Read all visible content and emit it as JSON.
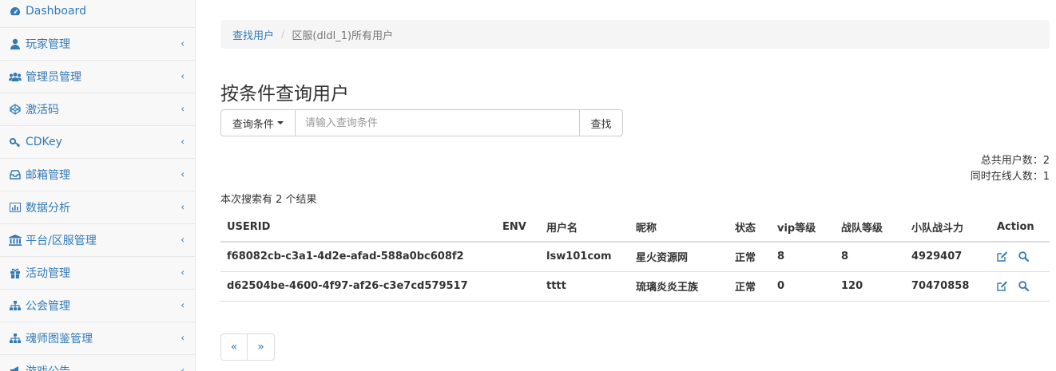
{
  "sidebar": {
    "items": [
      {
        "label": "Dashboard",
        "icon": "dashboard-icon",
        "has_submenu": false
      },
      {
        "label": "玩家管理",
        "icon": "user-icon",
        "has_submenu": true
      },
      {
        "label": "管理员管理",
        "icon": "users-icon",
        "has_submenu": true
      },
      {
        "label": "激活码",
        "icon": "codepen-icon",
        "has_submenu": true
      },
      {
        "label": "CDKey",
        "icon": "key-icon",
        "has_submenu": true
      },
      {
        "label": "邮箱管理",
        "icon": "inbox-icon",
        "has_submenu": true
      },
      {
        "label": "数据分析",
        "icon": "bar-chart-icon",
        "has_submenu": true
      },
      {
        "label": "平台/区服管理",
        "icon": "bank-icon",
        "has_submenu": true
      },
      {
        "label": "活动管理",
        "icon": "gift-icon",
        "has_submenu": true
      },
      {
        "label": "公会管理",
        "icon": "sitemap-icon",
        "has_submenu": true
      },
      {
        "label": "魂师图鉴管理",
        "icon": "sitemap-icon",
        "has_submenu": true
      },
      {
        "label": "游戏公告",
        "icon": "bullhorn-icon",
        "has_submenu": true
      }
    ]
  },
  "breadcrumb": {
    "link": "查找用户",
    "separator": "/",
    "active": "区服(dldl_1)所有用户"
  },
  "page_title": "按条件查询用户",
  "search": {
    "dropdown_label": "查询条件",
    "placeholder": "请输入查询条件",
    "button_label": "查找"
  },
  "stats": {
    "total_users": "总共用户数：2",
    "online_users": "同时在线人数：1"
  },
  "result_count": "本次搜索有 2 个结果",
  "table": {
    "headers": [
      "USERID",
      "ENV",
      "用户名",
      "昵称",
      "状态",
      "vip等级",
      "战队等级",
      "小队战斗力",
      "Action"
    ],
    "rows": [
      [
        "f68082cb-c3a1-4d2e-afad-588a0bc608f2",
        "",
        "lsw101com",
        "星火资源网",
        "正常",
        "8",
        "8",
        "4929407"
      ],
      [
        "d62504be-4600-4f97-af26-c3e7cd579517",
        "",
        "tttt",
        "琉璃炎炎王族",
        "正常",
        "0",
        "120",
        "70470858"
      ]
    ]
  },
  "pagination": {
    "prev": "«",
    "next": "»"
  },
  "colors": {
    "link": "#337ab7",
    "sidebar_bg": "#f8f8f8",
    "breadcrumb_bg": "#f5f5f5",
    "border": "#dddddd"
  }
}
